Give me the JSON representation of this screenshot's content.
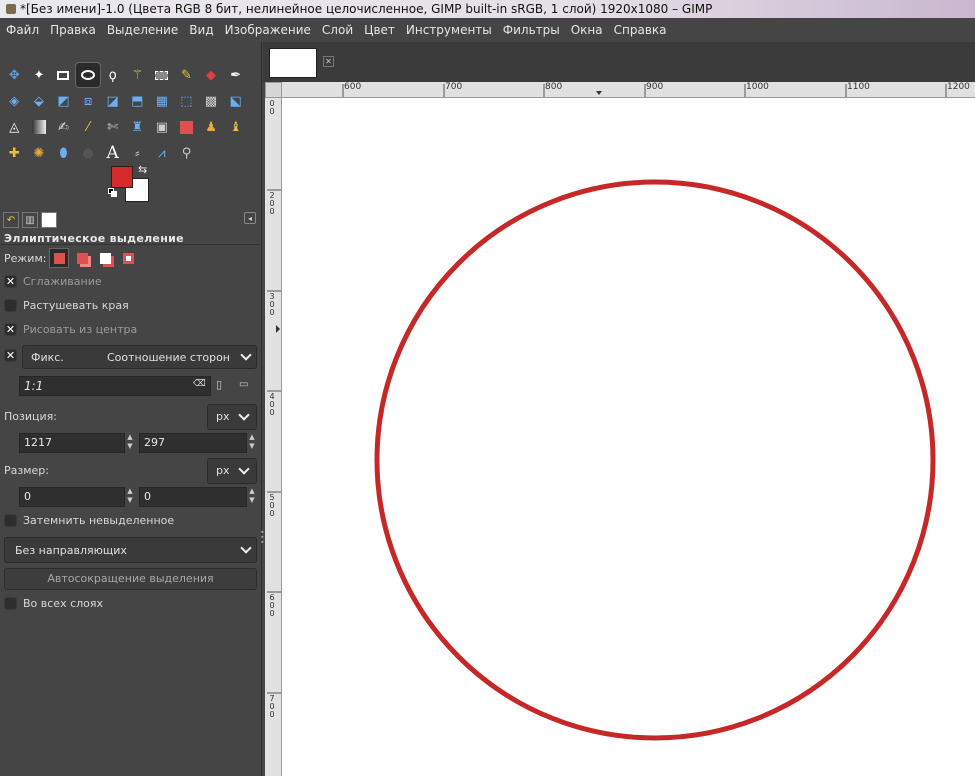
{
  "window": {
    "title": "*[Без имени]-1.0 (Цвета RGB 8 бит, нелинейное целочисленное, GIMP built-in sRGB, 1 слой) 1920x1080 – GIMP"
  },
  "menu": [
    "Файл",
    "Правка",
    "Выделение",
    "Вид",
    "Изображение",
    "Слой",
    "Цвет",
    "Инструменты",
    "Фильтры",
    "Окна",
    "Справка"
  ],
  "colors": {
    "foreground": "#d42a2a",
    "background": "#ffffff",
    "circle": "#c62828"
  },
  "tool_options": {
    "title": "Эллиптическое выделение",
    "mode_label": "Режим:",
    "antialias_label": "Сглаживание",
    "antialias_checked": true,
    "feather_label": "Растушевать края",
    "feather_checked": false,
    "from_center_label": "Рисовать из центра",
    "from_center_checked": true,
    "fixed_checked": true,
    "fixed_label": "Фикс.",
    "fixed_mode": "Соотношение сторон",
    "ratio_value": "1:1",
    "position_label": "Позиция:",
    "position_unit": "px",
    "position_x": "1217",
    "position_y": "297",
    "size_label": "Размер:",
    "size_unit": "px",
    "size_w": "0",
    "size_h": "0",
    "highlight_label": "Затемнить невыделенное",
    "highlight_checked": false,
    "guides_value": "Без направляющих",
    "autoshrink_label": "Автосокращение выделения",
    "all_layers_label": "Во всех слоях",
    "all_layers_checked": false
  },
  "ruler": {
    "h_labels": [
      "600",
      "700",
      "800",
      "900",
      "1000",
      "1100",
      "1200"
    ],
    "v_labels": [
      "1\n0\n0",
      "2\n0\n0",
      "3\n0\n0",
      "4\n0\n0",
      "5\n0\n0",
      "6\n0\n0",
      "7\n0\n0"
    ]
  }
}
